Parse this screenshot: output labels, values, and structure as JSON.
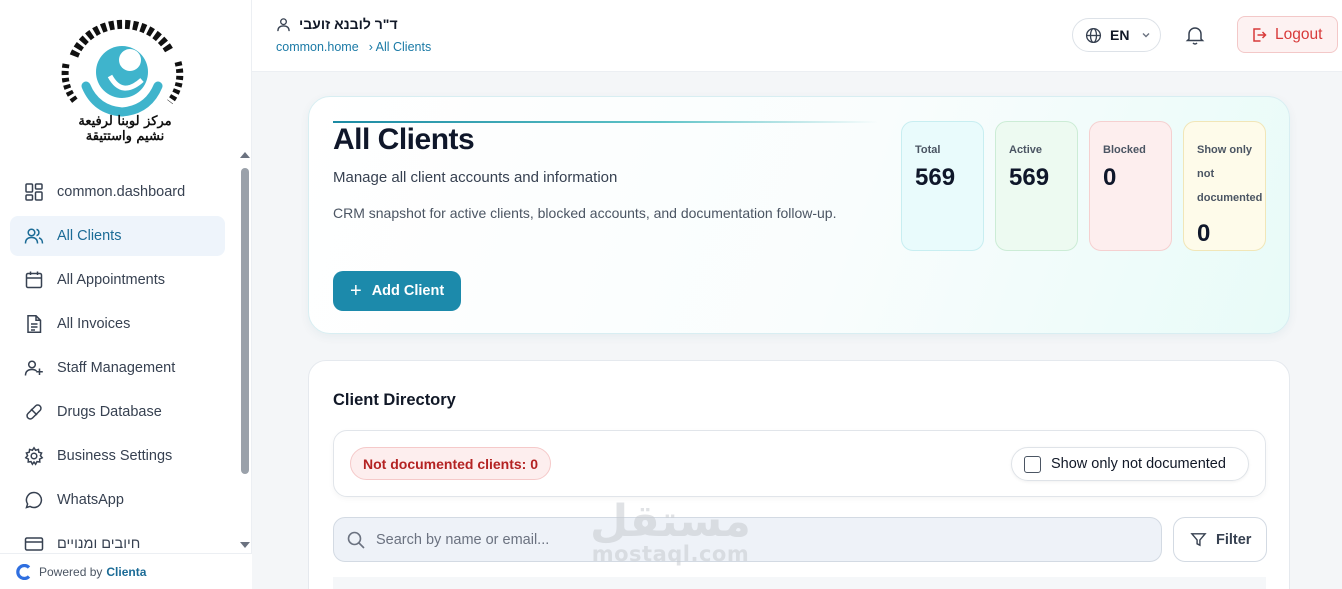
{
  "colors": {
    "accent": "#1c8aab",
    "danger": "#d83a3a",
    "link": "#1b7aa6"
  },
  "sidebar": {
    "logo_line1": "مركز لوبنا لرفيعة",
    "logo_line2": "نشيم واستتيقة",
    "items": [
      {
        "label": "common.dashboard",
        "icon": "dashboard-icon"
      },
      {
        "label": "All Clients",
        "icon": "users-icon",
        "active": true
      },
      {
        "label": "All Appointments",
        "icon": "calendar-icon"
      },
      {
        "label": "All Invoices",
        "icon": "invoice-icon"
      },
      {
        "label": "Staff Management",
        "icon": "user-plus-icon"
      },
      {
        "label": "Drugs Database",
        "icon": "pill-icon"
      },
      {
        "label": "Business Settings",
        "icon": "gear-icon"
      },
      {
        "label": "WhatsApp",
        "icon": "chat-icon"
      },
      {
        "label": "חיובים ומנויים",
        "icon": "credit-card-icon"
      }
    ],
    "powered_prefix": "Powered by",
    "powered_brand": "Clienta"
  },
  "header": {
    "user_name": "ד\"ר לובנא זועבי",
    "breadcrumb_home": "common.home",
    "breadcrumb_current": "› All Clients",
    "language": "EN",
    "logout_label": "Logout"
  },
  "hero": {
    "title": "All Clients",
    "subtitle": "Manage all client accounts and information",
    "description": "CRM snapshot for active clients, blocked accounts, and documentation follow-up.",
    "add_button": "Add Client",
    "stats": [
      {
        "label": "Total",
        "value": "569"
      },
      {
        "label": "Active",
        "value": "569"
      },
      {
        "label": "Blocked",
        "value": "0"
      },
      {
        "label": "Show only not documented",
        "value": "0"
      }
    ]
  },
  "directory": {
    "title": "Client Directory",
    "not_documented_badge": "Not documented clients: 0",
    "toggle_label": "Show only not documented",
    "search_placeholder": "Search by name or email...",
    "filter_label": "Filter"
  },
  "watermark": {
    "arabic": "مستقل",
    "latin": "mostaql.com"
  }
}
